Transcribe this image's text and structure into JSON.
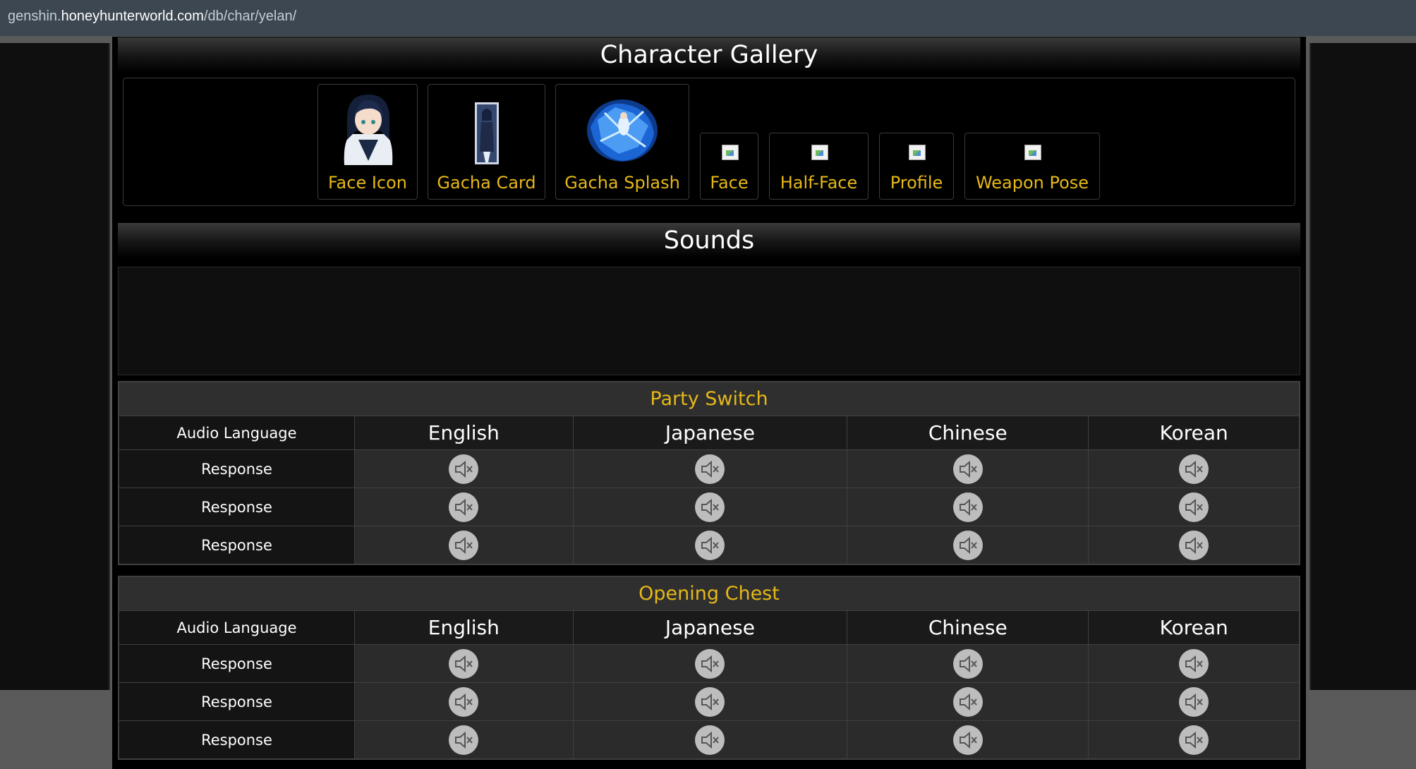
{
  "browser": {
    "url_prefix": "genshin.",
    "url_host": "honeyhunterworld.com",
    "url_path": "/db/char/yelan/"
  },
  "gallery": {
    "title": "Character Gallery",
    "items": [
      {
        "label": "Face Icon",
        "thumb": "yelan-face-icon"
      },
      {
        "label": "Gacha Card",
        "thumb": "yelan-gacha-card"
      },
      {
        "label": "Gacha Splash",
        "thumb": "yelan-gacha-splash"
      },
      {
        "label": "Face",
        "thumb": "broken-image-icon"
      },
      {
        "label": "Half-Face",
        "thumb": "broken-image-icon"
      },
      {
        "label": "Profile",
        "thumb": "broken-image-icon"
      },
      {
        "label": "Weapon Pose",
        "thumb": "broken-image-icon"
      }
    ]
  },
  "sounds": {
    "title": "Sounds",
    "tables": [
      {
        "caption": "Party Switch",
        "header_label": "Audio Language",
        "languages": [
          "English",
          "Japanese",
          "Chinese",
          "Korean"
        ],
        "rows": [
          "Response",
          "Response",
          "Response"
        ],
        "play_icon": "muted-speaker-icon"
      },
      {
        "caption": "Opening Chest",
        "header_label": "Audio Language",
        "languages": [
          "English",
          "Japanese",
          "Chinese",
          "Korean"
        ],
        "rows": [
          "Response",
          "Response",
          "Response"
        ],
        "play_icon": "muted-speaker-icon"
      }
    ]
  },
  "colors": {
    "accent_gold": "#e6b818",
    "background": "#000000",
    "url_bar": "#3c4752"
  }
}
